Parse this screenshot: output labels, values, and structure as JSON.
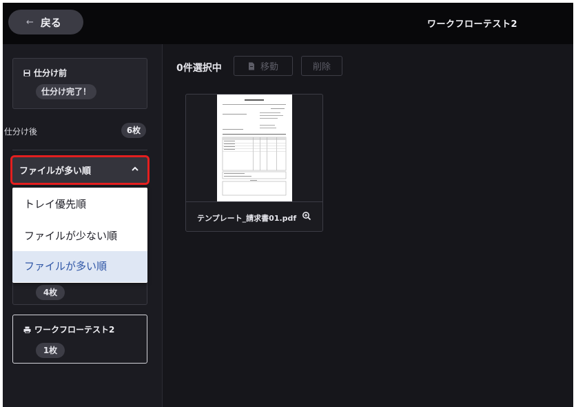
{
  "header": {
    "back_label": "戻る",
    "back_arrow": "←",
    "title": "ワークフローテスト2"
  },
  "sidebar": {
    "pre_sort": {
      "icon": "save-icon",
      "title": "仕分け前",
      "badge": "仕分け完了！"
    },
    "after_sort": {
      "label": "仕分け後",
      "count": "6枚"
    },
    "sort_select": {
      "value": "ファイルが多い順",
      "options": [
        "トレイ優先順",
        "ファイルが少ない順",
        "ファイルが多い順"
      ],
      "selected_index": 2
    },
    "hidden_group": {
      "count": "4枚"
    },
    "workflow_group": {
      "icon": "printer-icon",
      "title": "ワークフローテスト2",
      "count": "1枚"
    }
  },
  "main": {
    "selection_count": "0件選択中",
    "move_label": "移動",
    "delete_label": "削除",
    "files": [
      {
        "name": "テンプレート_請求書01.pdf"
      }
    ]
  },
  "colors": {
    "background": "#16161b",
    "header": "#08080a",
    "highlight": "#e41f1f",
    "selected_item_bg": "#dfe7f4",
    "selected_item_text": "#2f56a6"
  }
}
